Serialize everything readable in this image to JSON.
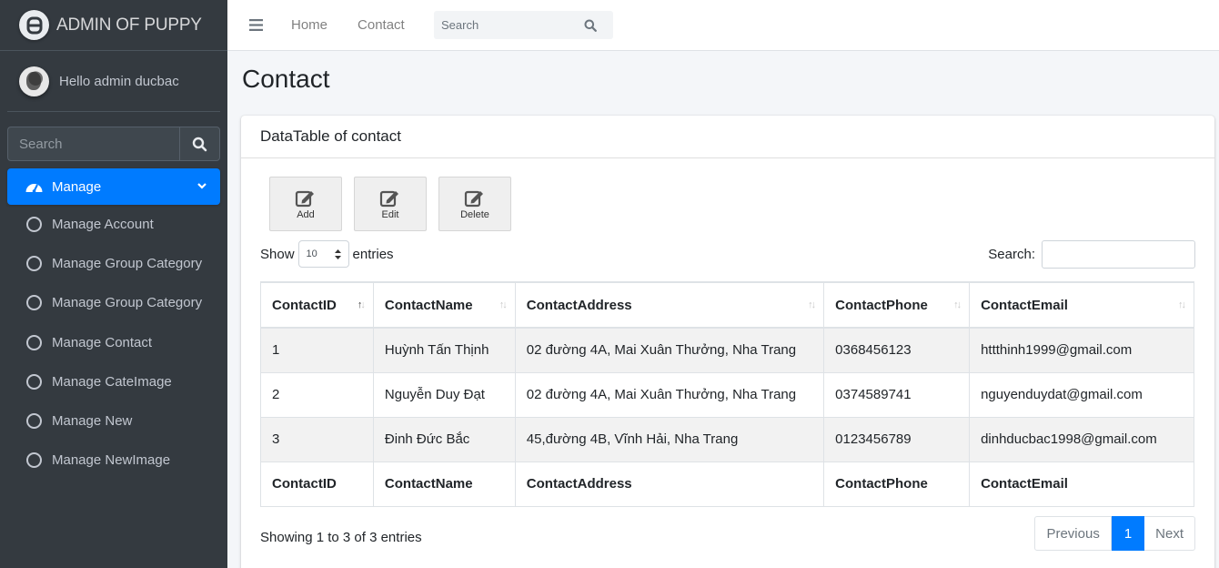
{
  "brand": {
    "title": "ADMIN OF PUPPY"
  },
  "user": {
    "greeting": "Hello admin ducbac"
  },
  "sidebar": {
    "search_placeholder": "Search",
    "active_item": "Manage",
    "items": [
      {
        "label": "Manage Account"
      },
      {
        "label": "Manage Group Category"
      },
      {
        "label": "Manage Group Category"
      },
      {
        "label": "Manage Contact"
      },
      {
        "label": "Manage CateImage"
      },
      {
        "label": "Manage New"
      },
      {
        "label": "Manage NewImage"
      }
    ]
  },
  "topnav": {
    "home": "Home",
    "contact": "Contact",
    "search_placeholder": "Search"
  },
  "page": {
    "title": "Contact",
    "card_title": "DataTable of contact"
  },
  "toolbar": {
    "add": "Add",
    "edit": "Edit",
    "delete": "Delete"
  },
  "table_controls": {
    "show": "Show",
    "page_length": "10",
    "entries": "entries",
    "search_label": "Search:"
  },
  "table": {
    "columns": [
      "ContactID",
      "ContactName",
      "ContactAddress",
      "ContactPhone",
      "ContactEmail"
    ],
    "rows": [
      [
        "1",
        "Huỳnh Tấn Thịnh",
        "02 đường 4A, Mai Xuân Thưởng, Nha Trang",
        "0368456123",
        "httthinh1999@gmail.com"
      ],
      [
        "2",
        "Nguyễn Duy Đạt",
        "02 đường 4A, Mai Xuân Thưởng, Nha Trang",
        "0374589741",
        "nguyenduydat@gmail.com"
      ],
      [
        "3",
        "Đinh Đức Bắc",
        "45,đường 4B, Vĩnh Hải, Nha Trang",
        "0123456789",
        "dinhducbac1998@gmail.com"
      ]
    ]
  },
  "footer": {
    "info": "Showing 1 to 3 of 3 entries",
    "previous": "Previous",
    "current_page": "1",
    "next": "Next"
  },
  "colors": {
    "sidebar_bg": "#343a40",
    "accent": "#007bff",
    "content_bg": "#f4f6f9"
  }
}
